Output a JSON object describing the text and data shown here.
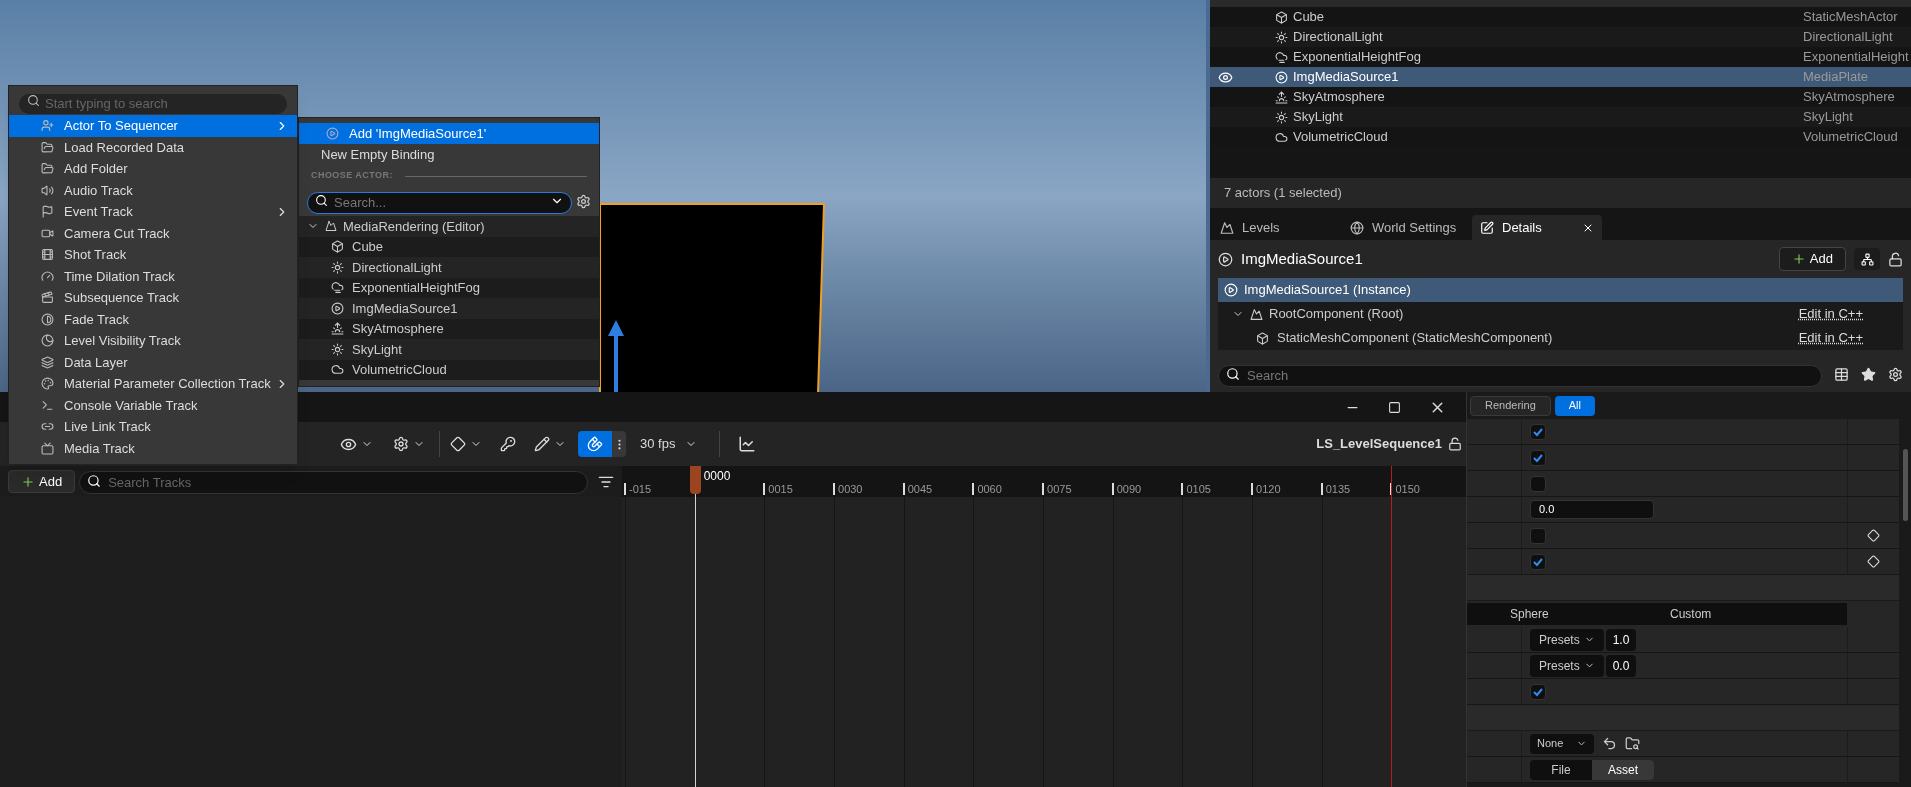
{
  "context_menu": {
    "search_placeholder": "Start typing to search",
    "items": [
      {
        "label": "Actor To Sequencer",
        "selected": true,
        "submenu": true
      },
      {
        "label": "Load Recorded Data",
        "selected": false,
        "submenu": false
      },
      {
        "label": "Add Folder",
        "selected": false,
        "submenu": false
      },
      {
        "label": "Audio Track",
        "selected": false,
        "submenu": false
      },
      {
        "label": "Event Track",
        "selected": false,
        "submenu": true
      },
      {
        "label": "Camera Cut Track",
        "selected": false,
        "submenu": false
      },
      {
        "label": "Shot Track",
        "selected": false,
        "submenu": false
      },
      {
        "label": "Time Dilation Track",
        "selected": false,
        "submenu": false
      },
      {
        "label": "Subsequence Track",
        "selected": false,
        "submenu": false
      },
      {
        "label": "Fade Track",
        "selected": false,
        "submenu": false
      },
      {
        "label": "Level Visibility Track",
        "selected": false,
        "submenu": false
      },
      {
        "label": "Data Layer",
        "selected": false,
        "submenu": false
      },
      {
        "label": "Material Parameter Collection Track",
        "selected": false,
        "submenu": true
      },
      {
        "label": "Console Variable Track",
        "selected": false,
        "submenu": false
      },
      {
        "label": "Live Link Track",
        "selected": false,
        "submenu": false
      },
      {
        "label": "Media Track",
        "selected": false,
        "submenu": false
      }
    ]
  },
  "submenu": {
    "actions": [
      {
        "label": "Add 'ImgMediaSource1'",
        "selected": true
      },
      {
        "label": "New Empty Binding",
        "selected": false
      }
    ],
    "section": "CHOOSE ACTOR:",
    "search_placeholder": "Search...",
    "tree": {
      "label": "MediaRendering (Editor)",
      "expanded": true,
      "children": [
        {
          "label": "Cube"
        },
        {
          "label": "DirectionalLight"
        },
        {
          "label": "ExponentialHeightFog"
        },
        {
          "label": "ImgMediaSource1"
        },
        {
          "label": "SkyAtmosphere"
        },
        {
          "label": "SkyLight"
        },
        {
          "label": "VolumetricCloud"
        }
      ]
    }
  },
  "outliner": {
    "rows": [
      {
        "name": "Cube",
        "type": "StaticMeshActor",
        "selected": false
      },
      {
        "name": "DirectionalLight",
        "type": "DirectionalLight",
        "selected": false
      },
      {
        "name": "ExponentialHeightFog",
        "type": "ExponentialHeight",
        "selected": false
      },
      {
        "name": "ImgMediaSource1",
        "type": "MediaPlate",
        "selected": true
      },
      {
        "name": "SkyAtmosphere",
        "type": "SkyAtmosphere",
        "selected": false
      },
      {
        "name": "SkyLight",
        "type": "SkyLight",
        "selected": false
      },
      {
        "name": "VolumetricCloud",
        "type": "VolumetricCloud",
        "selected": false
      }
    ],
    "status": "7 actors (1 selected)"
  },
  "tabs": [
    {
      "label": "Levels",
      "selected": false,
      "closable": false
    },
    {
      "label": "World Settings",
      "selected": false,
      "closable": false
    },
    {
      "label": "Details",
      "selected": true,
      "closable": true
    }
  ],
  "details": {
    "title": "ImgMediaSource1",
    "add_button": "Add",
    "components": [
      {
        "label": "ImgMediaSource1 (Instance)",
        "selected": true
      },
      {
        "label": "RootComponent (Root)",
        "selected": false,
        "link": "Edit in C++",
        "expanded": true,
        "children": [
          {
            "label": "StaticMeshComponent (StaticMeshComponent)",
            "selected": false,
            "link": "Edit in C++"
          }
        ]
      }
    ],
    "search_placeholder": "Search",
    "filters": [
      {
        "label": "Rendering",
        "selected": false
      },
      {
        "label": "All",
        "selected": true
      }
    ],
    "properties": [
      {
        "kind": "checkbox",
        "checked": true,
        "keyable": false
      },
      {
        "kind": "checkbox",
        "checked": true,
        "keyable": false
      },
      {
        "kind": "checkbox",
        "checked": false,
        "keyable": false
      },
      {
        "kind": "number",
        "value": "0.0"
      },
      {
        "kind": "checkbox",
        "checked": false,
        "keyable": true
      },
      {
        "kind": "checkbox",
        "checked": true,
        "keyable": true
      },
      {
        "kind": "section"
      },
      {
        "kind": "header",
        "cells": [
          "Sphere",
          "Custom"
        ]
      },
      {
        "kind": "presets",
        "button": "Presets",
        "value": "1.0"
      },
      {
        "kind": "presets",
        "button": "Presets",
        "value": "0.0"
      },
      {
        "kind": "checkbox",
        "checked": true,
        "keyable": false
      },
      {
        "kind": "section"
      },
      {
        "kind": "asset",
        "dropdown": "None"
      },
      {
        "kind": "segmented",
        "options": [
          {
            "label": "File",
            "selected": false
          },
          {
            "label": "Asset",
            "selected": true
          }
        ]
      }
    ]
  },
  "sequencer": {
    "fps": "30 fps",
    "snap_on": true,
    "sequence_name": "LS_LevelSequence1",
    "add_button": "Add",
    "search_placeholder": "Search Tracks",
    "playhead": "0000",
    "ticks": [
      "-015",
      "0015",
      "0030",
      "0045",
      "0060",
      "0075",
      "0090",
      "0105",
      "0120",
      "0135",
      "0150"
    ]
  }
}
